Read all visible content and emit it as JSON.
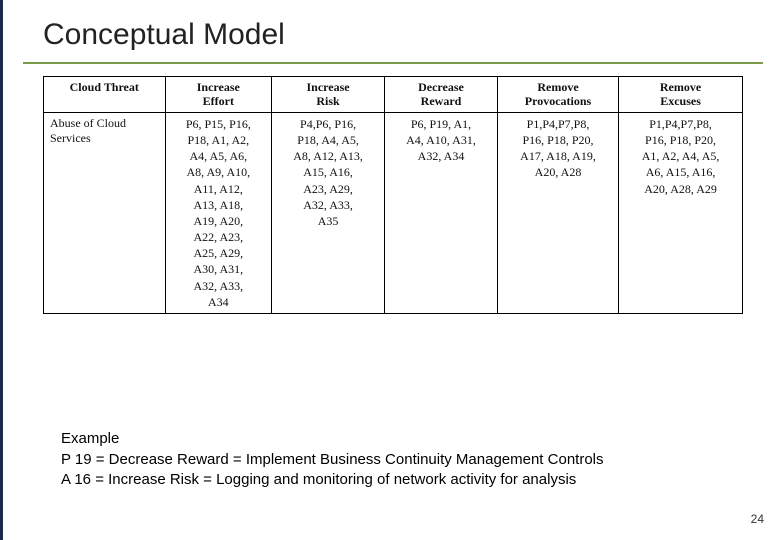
{
  "title": "Conceptual Model",
  "table": {
    "headers": [
      "Cloud Threat",
      "Increase Effort",
      "Increase Risk",
      "Decrease Reward",
      "Remove Provocations",
      "Remove Excuses"
    ],
    "row": {
      "threat": "Abuse of Cloud Services",
      "increase_effort": [
        "P6, P15, P16,",
        "P18, A1, A2,",
        "A4, A5, A6,",
        "A8, A9, A10,",
        "A11, A12,",
        "A13, A18,",
        "A19, A20,",
        "A22, A23,",
        "A25, A29,",
        "A30, A31,",
        "A32, A33,",
        "A34"
      ],
      "increase_risk": [
        "P4,P6, P16,",
        "P18, A4, A5,",
        "A8, A12, A13,",
        "A15, A16,",
        "A23, A29,",
        "A32, A33,",
        "A35"
      ],
      "decrease_reward": [
        "P6, P19, A1,",
        "A4, A10, A31,",
        "A32, A34"
      ],
      "remove_provocations": [
        "P1,P4,P7,P8,",
        "P16, P18, P20,",
        "A17, A18, A19,",
        "A20, A28"
      ],
      "remove_excuses": [
        "P1,P4,P7,P8,",
        "P16, P18, P20,",
        "A1, A2, A4, A5,",
        "A6, A15, A16,",
        "A20, A28, A29"
      ]
    }
  },
  "example": {
    "heading": "Example",
    "line1": "P 19  = Decrease Reward =  Implement Business Continuity Management Controls",
    "line2": "A 16 = Increase Risk = Logging and monitoring of network activity for analysis"
  },
  "page_number": "24"
}
